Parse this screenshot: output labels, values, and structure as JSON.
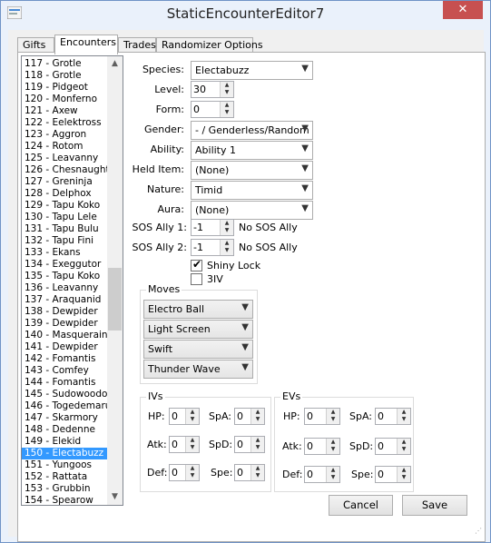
{
  "window": {
    "title": "StaticEncounterEditor7",
    "close_glyph": "✕"
  },
  "tabs": [
    "Gifts",
    "Encounters",
    "Trades",
    "Randomizer Options"
  ],
  "list": {
    "items": [
      "117 - Grotle",
      "118 - Grotle",
      "119 - Pidgeot",
      "120 - Monferno",
      "121 - Axew",
      "122 - Eelektross",
      "123 - Aggron",
      "124 - Rotom",
      "125 - Leavanny",
      "126 - Chesnaught",
      "127 - Greninja",
      "128 - Delphox",
      "129 - Tapu Koko",
      "130 - Tapu Lele",
      "131 - Tapu Bulu",
      "132 - Tapu Fini",
      "133 - Ekans",
      "134 - Exeggutor",
      "135 - Tapu Koko",
      "136 - Leavanny",
      "137 - Araquanid",
      "138 - Dewpider",
      "139 - Dewpider",
      "140 - Masquerain",
      "141 - Dewpider",
      "142 - Fomantis",
      "143 - Comfey",
      "144 - Fomantis",
      "145 - Sudowoodo",
      "146 - Togedemaru",
      "147 - Skarmory",
      "148 - Dedenne",
      "149 - Elekid",
      "150 - Electabuzz",
      "151 - Yungoos",
      "152 - Rattata",
      "153 - Grubbin",
      "154 - Spearow"
    ],
    "selected": "150 - Electabuzz",
    "scroll_up": "▲",
    "scroll_down": "▼"
  },
  "form": {
    "species_label": "Species:",
    "species": "Electabuzz",
    "level_label": "Level:",
    "level": "30",
    "form_label": "Form:",
    "form": "0",
    "gender_label": "Gender:",
    "gender": "- / Genderless/Random",
    "ability_label": "Ability:",
    "ability": "Ability 1",
    "held_item_label": "Held Item:",
    "held_item": "(None)",
    "nature_label": "Nature:",
    "nature": "Timid",
    "aura_label": "Aura:",
    "aura": "(None)",
    "sos1_label": "SOS Ally 1:",
    "sos1": "-1",
    "sos1_text": "No SOS Ally",
    "sos2_label": "SOS Ally 2:",
    "sos2": "-1",
    "sos2_text": "No SOS Ally",
    "shiny_lock_label": "Shiny Lock",
    "shiny_lock": true,
    "three_iv_label": "3IV",
    "three_iv": false
  },
  "moves": {
    "title": "Moves",
    "items": [
      "Electro Ball",
      "Light Screen",
      "Swift",
      "Thunder Wave"
    ]
  },
  "ivs": {
    "title": "IVs",
    "hp_label": "HP:",
    "atk_label": "Atk:",
    "def_label": "Def:",
    "spa_label": "SpA:",
    "spd_label": "SpD:",
    "spe_label": "Spe:",
    "hp": "0",
    "atk": "0",
    "def": "0",
    "spa": "0",
    "spd": "0",
    "spe": "0"
  },
  "evs": {
    "title": "EVs",
    "hp_label": "HP:",
    "atk_label": "Atk:",
    "def_label": "Def:",
    "spa_label": "SpA:",
    "spd_label": "SpD:",
    "spe_label": "Spe:",
    "hp": "0",
    "atk": "0",
    "def": "0",
    "spa": "0",
    "spd": "0",
    "spe": "0"
  },
  "buttons": {
    "cancel": "Cancel",
    "save": "Save"
  },
  "icons": {
    "dropdown": "▼",
    "spin_up": "▲",
    "spin_down": "▼",
    "check": "✔"
  }
}
